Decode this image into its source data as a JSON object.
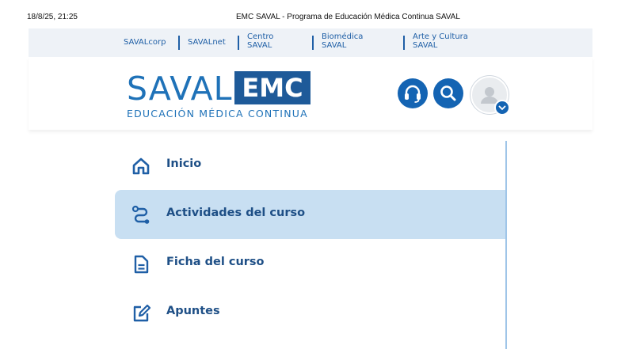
{
  "print_header": {
    "date": "18/8/25, 21:25",
    "title": "EMC SAVAL - Programa de Educación Médica Continua SAVAL"
  },
  "top_links": {
    "savalcorp": "SAVALcorp",
    "savalnet": "SAVALnet",
    "centro_line1": "Centro",
    "centro_line2": "SAVAL",
    "biomedica_line1": "Biomédica",
    "biomedica_line2": "SAVAL",
    "arte_line1": "Arte y Cultura",
    "arte_line2": "SAVAL"
  },
  "logo": {
    "saval": "SAVAL",
    "emc": "EMC",
    "subtitle": "EDUCACIÓN MÉDICA CONTINUA"
  },
  "header_icons": [
    "headset-icon",
    "search-icon",
    "user-avatar-icon",
    "chevron-down-icon"
  ],
  "menu": {
    "items": [
      {
        "label": "Inicio",
        "icon": "home-icon",
        "active": false
      },
      {
        "label": "Actividades del curso",
        "icon": "route-icon",
        "active": true
      },
      {
        "label": "Ficha del curso",
        "icon": "document-icon",
        "active": false
      },
      {
        "label": "Apuntes",
        "icon": "edit-icon",
        "active": false
      }
    ]
  },
  "colors": {
    "brand_blue": "#1464b3",
    "logo_blue": "#1f72b8",
    "emc_box": "#1e5a99",
    "menu_text": "#1e4f86",
    "active_bg": "#c8dff2",
    "topbar_bg": "#eef2f7"
  }
}
